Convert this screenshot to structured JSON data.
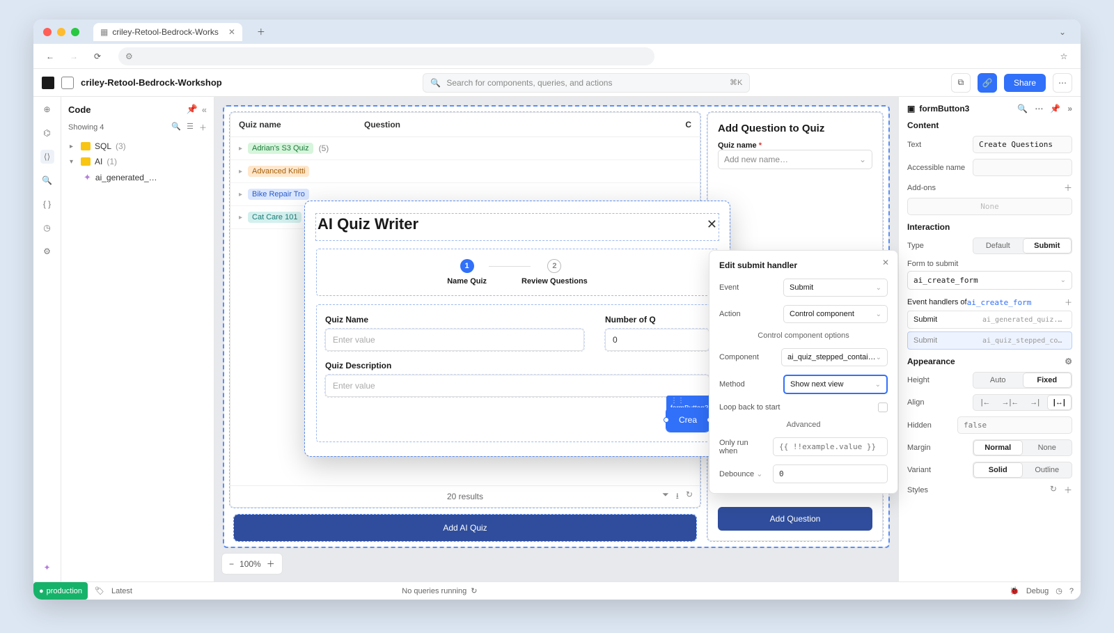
{
  "browser": {
    "tab_title": "criley-Retool-Bedrock-Works"
  },
  "app": {
    "title": "criley-Retool-Bedrock-Workshop",
    "search_placeholder": "Search for components, queries, and actions",
    "search_kbd": "⌘K",
    "share_label": "Share"
  },
  "code_panel": {
    "title": "Code",
    "showing": "Showing 4",
    "tree": {
      "sql": {
        "label": "SQL",
        "count": "(3)"
      },
      "ai": {
        "label": "AI",
        "count": "(1)"
      },
      "item": "ai_generated_…"
    }
  },
  "canvas": {
    "table": {
      "col_quiz": "Quiz name",
      "col_question": "Question",
      "col_c": "C",
      "rows": [
        {
          "name": "Adrian's S3 Quiz",
          "count": "(5)",
          "cls": "b-green"
        },
        {
          "name": "Advanced Knitti",
          "cls": "b-orange"
        },
        {
          "name": "Bike Repair Tro",
          "cls": "b-blue"
        },
        {
          "name": "Cat Care 101",
          "cls": "b-teal"
        }
      ],
      "results": "20 results"
    },
    "add_ai_quiz": "Add AI Quiz",
    "sidecard": {
      "title": "Add Question to Quiz",
      "quiz_name_label": "Quiz name",
      "quiz_name_placeholder": "Add new name…",
      "add_question": "Add Question"
    },
    "zoom": "100%"
  },
  "modal": {
    "title": "AI Quiz Writer",
    "step1": "Name Quiz",
    "step2": "Review Questions",
    "quiz_name_label": "Quiz Name",
    "quiz_name_placeholder": "Enter value",
    "num_label": "Number of Q",
    "num_value": "0",
    "desc_label": "Quiz Description",
    "desc_placeholder": "Enter value",
    "create_label": "Crea",
    "component_tag": "formButton3"
  },
  "popover": {
    "title": "Edit submit handler",
    "event_label": "Event",
    "event_value": "Submit",
    "action_label": "Action",
    "action_value": "Control component",
    "section_cco": "Control component options",
    "component_label": "Component",
    "component_value": "ai_quiz_stepped_contai…",
    "method_label": "Method",
    "method_value": "Show next view",
    "loop_label": "Loop back to start",
    "section_adv": "Advanced",
    "only_run_label": "Only run when",
    "only_run_placeholder": "{{ !!example.value }}",
    "debounce_label": "Debounce",
    "debounce_value": "0"
  },
  "inspector": {
    "name": "formButton3",
    "content_h": "Content",
    "text_label": "Text",
    "text_value": "Create Questions",
    "acc_label": "Accessible name",
    "addons_label": "Add-ons",
    "addons_none": "None",
    "interaction_h": "Interaction",
    "type_label": "Type",
    "type_default": "Default",
    "type_submit": "Submit",
    "form_label": "Form to submit",
    "form_value": "ai_create_form",
    "handlers_of": "Event handlers of ",
    "handlers_link": "ai_create_form",
    "handler1_ev": "Submit",
    "handler1_trg": "ai_generated_quiz.tri…",
    "handler2_ev": "Submit",
    "handler2_trg": "ai_quiz_stepped_conta…",
    "appearance_h": "Appearance",
    "height_label": "Height",
    "height_auto": "Auto",
    "height_fixed": "Fixed",
    "align_label": "Align",
    "hidden_label": "Hidden",
    "hidden_placeholder": "false",
    "margin_label": "Margin",
    "margin_normal": "Normal",
    "margin_none": "None",
    "variant_label": "Variant",
    "variant_solid": "Solid",
    "variant_outline": "Outline",
    "styles_label": "Styles"
  },
  "footer": {
    "env": "production",
    "latest": "Latest",
    "noqueries": "No queries running",
    "debug": "Debug"
  }
}
